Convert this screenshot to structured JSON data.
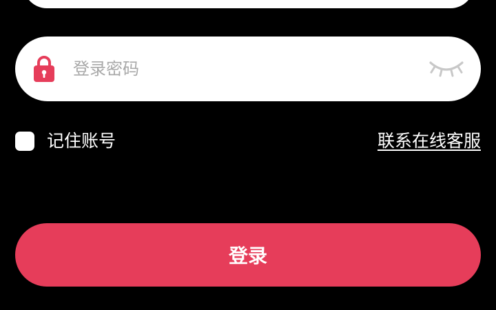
{
  "password": {
    "placeholder": "登录密码",
    "value": "",
    "lock_icon": "lock-icon",
    "visibility_icon": "eye-closed-icon"
  },
  "remember": {
    "label": "记住账号",
    "checked": false
  },
  "support": {
    "label": "联系在线客服"
  },
  "login": {
    "label": "登录"
  },
  "colors": {
    "background": "#000000",
    "field": "#ffffff",
    "accent": "#e63d5a",
    "placeholder": "#a8a8a8",
    "eye": "#c8c8c8"
  }
}
